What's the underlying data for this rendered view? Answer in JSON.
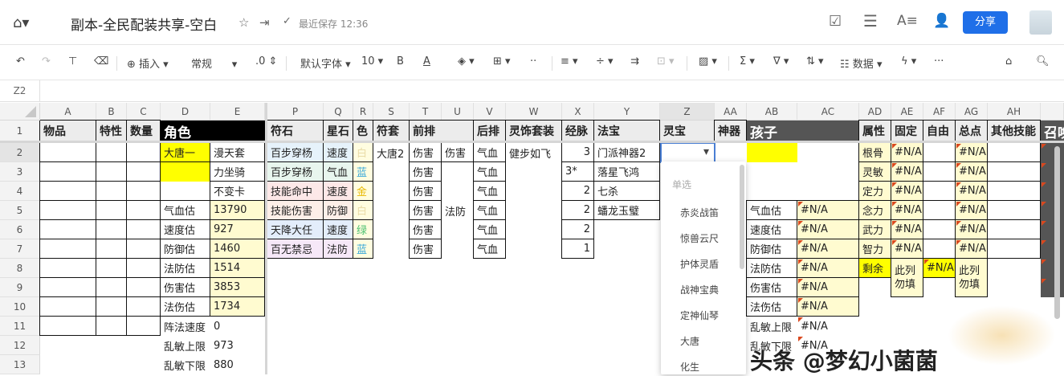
{
  "app": {
    "title": "副本-全民配装共享-空白",
    "saved": "最近保存 12:36",
    "share": "分享"
  },
  "toolbar": {
    "insert": "插入",
    "format": "常规",
    "decimal": ".0",
    "font": "默认字体",
    "size": "10",
    "bold": "B",
    "font_color": "A",
    "data": "数据",
    "more": "···"
  },
  "formula_bar": {
    "cell_ref": "Z2"
  },
  "columns": [
    "A",
    "B",
    "C",
    "D",
    "E",
    "P",
    "Q",
    "R",
    "S",
    "T",
    "U",
    "V",
    "W",
    "X",
    "Y",
    "Z",
    "AA",
    "AB",
    "AC",
    "AD",
    "AE",
    "AF",
    "AG",
    "AH",
    ""
  ],
  "rows": [
    "1",
    "2",
    "3",
    "4",
    "5",
    "6",
    "7",
    "8",
    "9",
    "10",
    "11",
    "12",
    "13"
  ],
  "colors": {
    "yellow": "#ffff00",
    "light_yellow": "#fffbd0",
    "dark": "#555555",
    "black": "#000000",
    "accent": "#1f6fe8",
    "blue_text": "#3aa8d8",
    "gold_text": "#e8b800",
    "green_text": "#4cc070",
    "white_text": "#e9dca8"
  },
  "cells": [
    {
      "a": "A1",
      "v": "物品",
      "k": "h b"
    },
    {
      "a": "B1",
      "v": "特性",
      "k": "h b"
    },
    {
      "a": "C1",
      "v": "数量",
      "k": "h b"
    },
    {
      "a": "D1",
      "to": "E1",
      "v": "角色",
      "k": "h",
      "bg": "#000000",
      "fg": "#ffffff"
    },
    {
      "a": "P1",
      "v": "符石",
      "k": "h b"
    },
    {
      "a": "Q1",
      "v": "星石",
      "k": "h b"
    },
    {
      "a": "R1",
      "v": "色",
      "k": "h b"
    },
    {
      "a": "S1",
      "v": "符套",
      "k": "h b"
    },
    {
      "a": "T1",
      "to": "U1",
      "v": "前排",
      "k": "h b"
    },
    {
      "a": "V1",
      "v": "后排",
      "k": "h b"
    },
    {
      "a": "W1",
      "v": "灵饰套装",
      "k": "h b"
    },
    {
      "a": "X1",
      "v": "经脉",
      "k": "h b"
    },
    {
      "a": "Y1",
      "v": "法宝",
      "k": "h b"
    },
    {
      "a": "Z1",
      "v": "灵宝",
      "k": "h"
    },
    {
      "a": "AA1",
      "v": "神器",
      "k": "h b"
    },
    {
      "a": "AB1",
      "to": "AC1",
      "v": "孩子",
      "k": "h",
      "bg": "#555555",
      "fg": "#ffffff"
    },
    {
      "a": "AD1",
      "v": "属性",
      "k": "h b"
    },
    {
      "a": "AE1",
      "v": "固定",
      "k": "h b"
    },
    {
      "a": "AF1",
      "v": "自由",
      "k": "h b"
    },
    {
      "a": "AG1",
      "v": "总点",
      "k": "h b"
    },
    {
      "a": "AH1",
      "v": "其他技能",
      "k": "h b"
    },
    {
      "a": "AI1",
      "v": "召唤",
      "k": "h",
      "bg": "#555555",
      "fg": "#ffffff"
    },
    {
      "a": "A2",
      "v": "",
      "k": "b"
    },
    {
      "a": "B2",
      "v": "",
      "k": "b"
    },
    {
      "a": "C2",
      "v": "",
      "k": "b"
    },
    {
      "a": "A3",
      "v": "",
      "k": "b"
    },
    {
      "a": "B3",
      "v": "",
      "k": "b"
    },
    {
      "a": "C3",
      "v": "",
      "k": "b"
    },
    {
      "a": "A4",
      "v": "",
      "k": "b"
    },
    {
      "a": "B4",
      "v": "",
      "k": "b"
    },
    {
      "a": "C4",
      "v": "",
      "k": "b"
    },
    {
      "a": "A5",
      "v": "",
      "k": "b"
    },
    {
      "a": "B5",
      "v": "",
      "k": "b"
    },
    {
      "a": "C5",
      "v": "",
      "k": "b"
    },
    {
      "a": "A6",
      "v": "",
      "k": "b"
    },
    {
      "a": "B6",
      "v": "",
      "k": "b"
    },
    {
      "a": "C6",
      "v": "",
      "k": "b"
    },
    {
      "a": "A7",
      "v": "",
      "k": "b"
    },
    {
      "a": "B7",
      "v": "",
      "k": "b"
    },
    {
      "a": "C7",
      "v": "",
      "k": "b"
    },
    {
      "a": "A8",
      "v": "",
      "k": "b"
    },
    {
      "a": "B8",
      "v": "",
      "k": "b"
    },
    {
      "a": "C8",
      "v": "",
      "k": "b"
    },
    {
      "a": "A9",
      "v": "",
      "k": "b"
    },
    {
      "a": "B9",
      "v": "",
      "k": "b"
    },
    {
      "a": "C9",
      "v": "",
      "k": "b"
    },
    {
      "a": "A10",
      "v": "",
      "k": "b"
    },
    {
      "a": "B10",
      "v": "",
      "k": "b"
    },
    {
      "a": "C10",
      "v": "",
      "k": "b"
    },
    {
      "a": "A11",
      "v": "",
      "k": "b"
    },
    {
      "a": "B11",
      "v": "",
      "k": "b"
    },
    {
      "a": "C11",
      "v": "",
      "k": "b"
    },
    {
      "a": "D2",
      "v": "大唐一",
      "k": "b",
      "bg": "#ffff00"
    },
    {
      "a": "E2",
      "v": "漫天套",
      "k": "b"
    },
    {
      "a": "D3",
      "v": "",
      "bg": "#ffff00"
    },
    {
      "a": "E3",
      "v": "力坐骑",
      "k": "b"
    },
    {
      "a": "E4",
      "v": "不变卡",
      "k": "b"
    },
    {
      "a": "D5",
      "v": "气血估",
      "k": "b"
    },
    {
      "a": "E5",
      "v": "13790",
      "k": "b",
      "bg": "#fffbd0"
    },
    {
      "a": "D6",
      "v": "速度估",
      "k": "b"
    },
    {
      "a": "E6",
      "v": "927",
      "k": "b",
      "bg": "#fffbd0"
    },
    {
      "a": "D7",
      "v": "防御估",
      "k": "b"
    },
    {
      "a": "E7",
      "v": "1460",
      "k": "b",
      "bg": "#fffbd0"
    },
    {
      "a": "D8",
      "v": "法防估",
      "k": "b"
    },
    {
      "a": "E8",
      "v": "1514",
      "k": "b",
      "bg": "#fffbd0"
    },
    {
      "a": "D9",
      "v": "伤害估",
      "k": "b"
    },
    {
      "a": "E9",
      "v": "3853",
      "k": "b",
      "bg": "#fffbd0"
    },
    {
      "a": "D10",
      "v": "法伤估",
      "k": "b"
    },
    {
      "a": "E10",
      "v": "1734",
      "k": "b",
      "bg": "#fffbd0"
    },
    {
      "a": "D11",
      "v": "阵法速度"
    },
    {
      "a": "E11",
      "v": "0"
    },
    {
      "a": "D12",
      "v": "乱敏上限"
    },
    {
      "a": "E12",
      "v": "973"
    },
    {
      "a": "D13",
      "v": "乱敏下限"
    },
    {
      "a": "E13",
      "v": "880"
    },
    {
      "a": "P2",
      "v": "百步穿杨",
      "k": "b",
      "bg": "#e6f2fb"
    },
    {
      "a": "Q2",
      "v": "速度",
      "k": "b",
      "bg": "#e6f2fb"
    },
    {
      "a": "R2",
      "v": "白",
      "k": "b",
      "bg": "#fffde0",
      "fg": "#e9dca8"
    },
    {
      "a": "P3",
      "v": "百步穿杨",
      "k": "b",
      "bg": "#e8f6ee"
    },
    {
      "a": "Q3",
      "v": "气血",
      "k": "b",
      "bg": "#e8f6ee"
    },
    {
      "a": "R3",
      "v": "蓝",
      "k": "b",
      "bg": "#fffde0",
      "fg": "#3aa8d8"
    },
    {
      "a": "P4",
      "v": "技能命中",
      "k": "b",
      "bg": "#fde8e8"
    },
    {
      "a": "Q4",
      "v": "速度",
      "k": "b",
      "bg": "#fde8e8"
    },
    {
      "a": "R4",
      "v": "金",
      "k": "b",
      "bg": "#fffde0",
      "fg": "#e8b800"
    },
    {
      "a": "P5",
      "v": "技能伤害",
      "k": "b",
      "bg": "#fdefe8"
    },
    {
      "a": "Q5",
      "v": "防御",
      "k": "b",
      "bg": "#fdefe8"
    },
    {
      "a": "R5",
      "v": "白",
      "k": "b",
      "bg": "#fffde0",
      "fg": "#e9dca8"
    },
    {
      "a": "P6",
      "v": "天降大任",
      "k": "b",
      "bg": "#e3edfb"
    },
    {
      "a": "Q6",
      "v": "速度",
      "k": "b",
      "bg": "#e3edfb"
    },
    {
      "a": "R6",
      "v": "绿",
      "k": "b",
      "bg": "#fffde0",
      "fg": "#4cc070"
    },
    {
      "a": "P7",
      "v": "百无禁忌",
      "k": "b",
      "bg": "#f6e8f8"
    },
    {
      "a": "Q7",
      "v": "法防",
      "k": "b",
      "bg": "#f6e8f8"
    },
    {
      "a": "R7",
      "v": "蓝",
      "k": "b",
      "bg": "#fffde0",
      "fg": "#3aa8d8"
    },
    {
      "a": "S2",
      "v": "大唐2"
    },
    {
      "a": "T2",
      "v": "伤害",
      "k": "b"
    },
    {
      "a": "U2",
      "v": "伤害",
      "k": "b"
    },
    {
      "a": "V2",
      "v": "气血",
      "k": "b"
    },
    {
      "a": "W2",
      "v": "健步如飞"
    },
    {
      "a": "T3",
      "v": "伤害",
      "k": "b"
    },
    {
      "a": "V3",
      "v": "气血",
      "k": "b"
    },
    {
      "a": "T4",
      "v": "伤害",
      "k": "b"
    },
    {
      "a": "V4",
      "v": "气血",
      "k": "b"
    },
    {
      "a": "T5",
      "v": "伤害",
      "k": "b"
    },
    {
      "a": "U5",
      "v": "法防"
    },
    {
      "a": "V5",
      "v": "气血",
      "k": "b"
    },
    {
      "a": "T6",
      "v": "伤害",
      "k": "b"
    },
    {
      "a": "V6",
      "v": "气血",
      "k": "b"
    },
    {
      "a": "T7",
      "v": "伤害",
      "k": "b"
    },
    {
      "a": "V7",
      "v": "气血",
      "k": "b"
    },
    {
      "a": "X2",
      "v": "3",
      "k": "b r"
    },
    {
      "a": "X3",
      "v": "3*",
      "k": "b"
    },
    {
      "a": "X4",
      "v": "2",
      "k": "b r"
    },
    {
      "a": "X5",
      "v": "2",
      "k": "b r"
    },
    {
      "a": "X6",
      "v": "2",
      "k": "b r"
    },
    {
      "a": "X7",
      "v": "1",
      "k": "b r"
    },
    {
      "a": "Y2",
      "v": "门派神器2",
      "k": "b"
    },
    {
      "a": "Y3",
      "v": "落星飞鸿",
      "k": "b"
    },
    {
      "a": "Y4",
      "v": "七杀",
      "k": "b"
    },
    {
      "a": "Y5",
      "v": "蟠龙玉璧",
      "k": "b"
    },
    {
      "a": "AB2",
      "v": "",
      "bg": "#ffff00"
    },
    {
      "a": "AB5",
      "v": "气血估",
      "k": "b"
    },
    {
      "a": "AC5",
      "v": "#N/A",
      "k": "b tri",
      "bg": "#fffbd0"
    },
    {
      "a": "AB6",
      "v": "速度估",
      "k": "b"
    },
    {
      "a": "AC6",
      "v": "#N/A",
      "k": "b tri",
      "bg": "#fffbd0"
    },
    {
      "a": "AB7",
      "v": "防御估",
      "k": "b"
    },
    {
      "a": "AC7",
      "v": "#N/A",
      "k": "b tri",
      "bg": "#fffbd0"
    },
    {
      "a": "AB8",
      "v": "法防估",
      "k": "b"
    },
    {
      "a": "AC8",
      "v": "#N/A",
      "k": "b tri",
      "bg": "#fffbd0"
    },
    {
      "a": "AB9",
      "v": "伤害估",
      "k": "b"
    },
    {
      "a": "AC9",
      "v": "#N/A",
      "k": "b tri",
      "bg": "#fffbd0"
    },
    {
      "a": "AB10",
      "v": "法伤估",
      "k": "b"
    },
    {
      "a": "AC10",
      "v": "#N/A",
      "k": "b tri",
      "bg": "#fffbd0"
    },
    {
      "a": "AB11",
      "v": "乱敏上限"
    },
    {
      "a": "AC11",
      "v": "#N/A",
      "k": "tri"
    },
    {
      "a": "AB12",
      "v": "乱敏下限"
    },
    {
      "a": "AC12",
      "v": "#N/A",
      "k": "tri"
    },
    {
      "a": "AD2",
      "v": "根骨",
      "k": "b",
      "bg": "#fffbd0"
    },
    {
      "a": "AE2",
      "v": "#N/A",
      "k": "b tri",
      "bg": "#fffbd0"
    },
    {
      "a": "AF2",
      "v": "",
      "k": "b"
    },
    {
      "a": "AG2",
      "v": "#N/A",
      "k": "b tri",
      "bg": "#fffbd0"
    },
    {
      "a": "AD3",
      "v": "灵敏",
      "k": "b",
      "bg": "#fffbd0"
    },
    {
      "a": "AE3",
      "v": "#N/A",
      "k": "b tri",
      "bg": "#fffbd0"
    },
    {
      "a": "AF3",
      "v": "",
      "k": "b"
    },
    {
      "a": "AG3",
      "v": "#N/A",
      "k": "b tri",
      "bg": "#fffbd0"
    },
    {
      "a": "AD4",
      "v": "定力",
      "k": "b",
      "bg": "#fffbd0"
    },
    {
      "a": "AE4",
      "v": "#N/A",
      "k": "b tri",
      "bg": "#fffbd0"
    },
    {
      "a": "AF4",
      "v": "",
      "k": "b"
    },
    {
      "a": "AG4",
      "v": "#N/A",
      "k": "b tri",
      "bg": "#fffbd0"
    },
    {
      "a": "AD5",
      "v": "念力",
      "k": "b",
      "bg": "#fffbd0"
    },
    {
      "a": "AE5",
      "v": "#N/A",
      "k": "b tri",
      "bg": "#fffbd0"
    },
    {
      "a": "AF5",
      "v": "",
      "k": "b"
    },
    {
      "a": "AG5",
      "v": "#N/A",
      "k": "b tri",
      "bg": "#fffbd0"
    },
    {
      "a": "AD6",
      "v": "武力",
      "k": "b",
      "bg": "#fffbd0"
    },
    {
      "a": "AE6",
      "v": "#N/A",
      "k": "b tri",
      "bg": "#fffbd0"
    },
    {
      "a": "AF6",
      "v": "",
      "k": "b"
    },
    {
      "a": "AG6",
      "v": "#N/A",
      "k": "b tri",
      "bg": "#fffbd0"
    },
    {
      "a": "AD7",
      "v": "智力",
      "k": "b",
      "bg": "#fffbd0"
    },
    {
      "a": "AE7",
      "v": "#N/A",
      "k": "b tri",
      "bg": "#fffbd0"
    },
    {
      "a": "AF7",
      "v": "",
      "k": "b"
    },
    {
      "a": "AG7",
      "v": "#N/A",
      "k": "b tri",
      "bg": "#fffbd0"
    },
    {
      "a": "AD8",
      "v": "剩余",
      "k": "b",
      "bg": "#ffff00"
    },
    {
      "a": "AE8",
      "to": "AE9",
      "v": "此列勿填",
      "k": "b wrap",
      "bg": "#fffbd0"
    },
    {
      "a": "AF8",
      "v": "#N/A",
      "k": "b tri",
      "bg": "#ffff00"
    },
    {
      "a": "AG8",
      "to": "AG9",
      "v": "此列勿填",
      "k": "b wrap",
      "bg": "#fffbd0"
    },
    {
      "a": "AH2",
      "v": "",
      "k": "b"
    },
    {
      "a": "AH3",
      "v": "",
      "k": "b"
    },
    {
      "a": "AH4",
      "v": "",
      "k": "b"
    },
    {
      "a": "AH5",
      "v": "",
      "k": "b"
    },
    {
      "a": "AH6",
      "v": "",
      "k": "b"
    },
    {
      "a": "AH7",
      "v": "",
      "k": "b"
    },
    {
      "a": "AI2",
      "v": "",
      "k": "tri",
      "bg": "#555555"
    },
    {
      "a": "AI3",
      "v": "",
      "k": "tri",
      "bg": "#555555"
    },
    {
      "a": "AI4",
      "v": "",
      "k": "tri",
      "bg": "#555555"
    },
    {
      "a": "AI5",
      "v": "",
      "k": "tri",
      "bg": "#555555"
    },
    {
      "a": "AI6",
      "v": "",
      "k": "tri",
      "bg": "#555555"
    },
    {
      "a": "AI7",
      "v": "",
      "k": "tri",
      "bg": "#555555"
    },
    {
      "a": "AI8",
      "v": "",
      "k": "tri",
      "bg": "#555555"
    },
    {
      "a": "AI9",
      "v": "",
      "k": "tri",
      "bg": "#555555"
    }
  ],
  "dropdown": {
    "header": "单选",
    "options": [
      "赤炎战笛",
      "惊兽云尺",
      "护体灵盾",
      "战神宝典",
      "定神仙琴",
      "大唐",
      "化生"
    ]
  },
  "watermark": "头条 @梦幻小菌菌"
}
